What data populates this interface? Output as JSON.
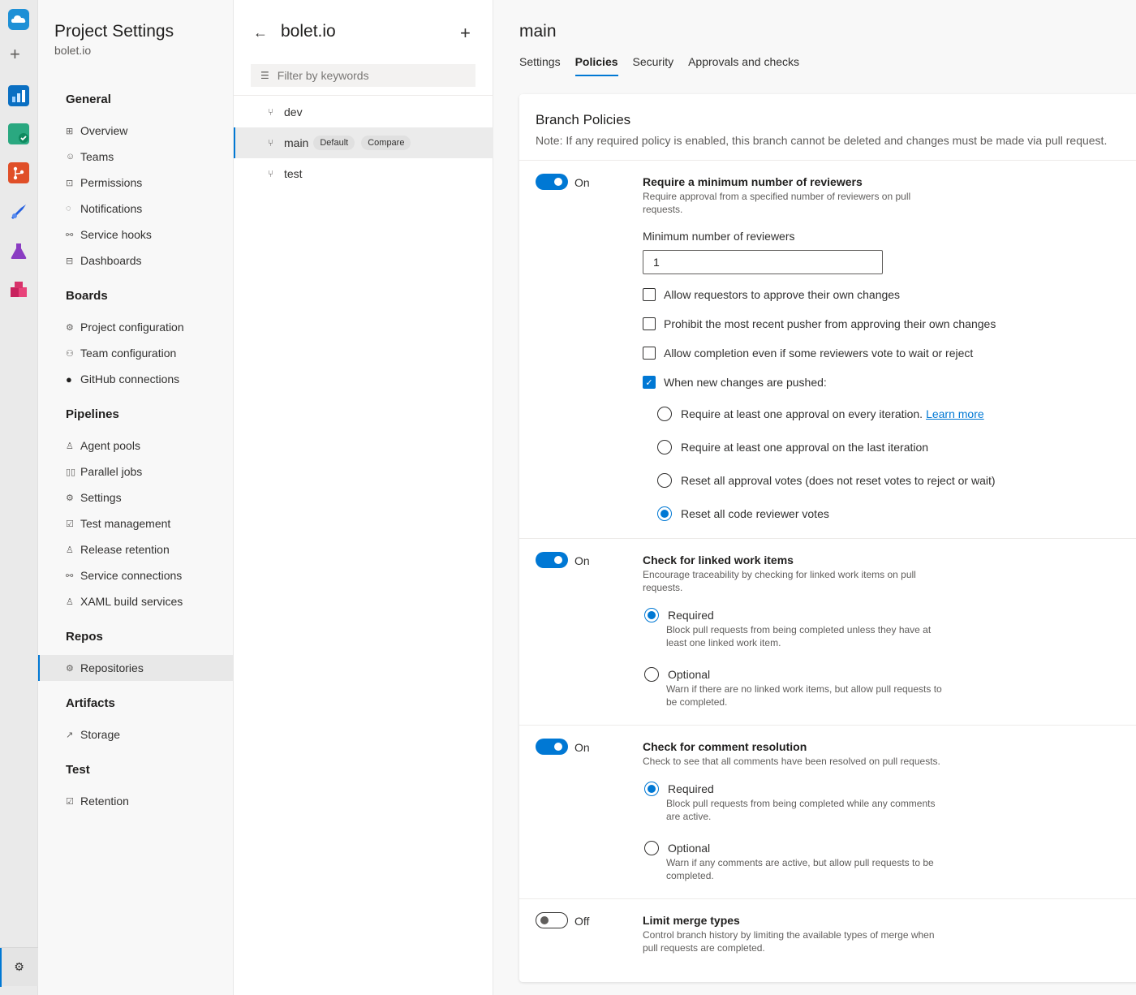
{
  "rail": {
    "icons": [
      "azure-devops-logo-icon",
      "add-icon",
      "boards-icon",
      "test-plans-icon",
      "repos-icon",
      "pipelines-icon",
      "test-flask-icon",
      "artifacts-icon",
      "settings-gear-icon"
    ],
    "gear_glyph": "⚙"
  },
  "sidebar": {
    "title": "Project Settings",
    "subtitle": "bolet.io",
    "sections": {
      "general": "General",
      "boards": "Boards",
      "pipelines": "Pipelines",
      "repos": "Repos",
      "artifacts": "Artifacts",
      "test": "Test"
    },
    "items": {
      "overview": "Overview",
      "teams": "Teams",
      "permissions": "Permissions",
      "notifications": "Notifications",
      "service_hooks": "Service hooks",
      "dashboards": "Dashboards",
      "project_configuration": "Project configuration",
      "team_configuration": "Team configuration",
      "github_connections": "GitHub connections",
      "agent_pools": "Agent pools",
      "parallel_jobs": "Parallel jobs",
      "settings": "Settings",
      "test_management": "Test management",
      "release_retention": "Release retention",
      "service_connections": "Service connections",
      "xaml_build_services": "XAML build services",
      "repositories": "Repositories",
      "storage": "Storage",
      "retention": "Retention"
    }
  },
  "branches": {
    "repo_name": "bolet.io",
    "filter_placeholder": "Filter by keywords",
    "list": [
      {
        "name": "dev"
      },
      {
        "name": "main",
        "badge_default": "Default",
        "badge_compare": "Compare"
      },
      {
        "name": "test"
      }
    ]
  },
  "main": {
    "title": "main",
    "tabs": [
      "Settings",
      "Policies",
      "Security",
      "Approvals and checks"
    ],
    "active_tab": "Policies"
  },
  "policies": {
    "header_title": "Branch Policies",
    "header_note": "Note: If any required policy is enabled, this branch cannot be deleted and changes must be made via pull request.",
    "min_reviewers": {
      "toggle_label": "On",
      "title": "Require a minimum number of reviewers",
      "desc": "Require approval from a specified number of reviewers on pull requests.",
      "field_label": "Minimum number of reviewers",
      "field_value": "1",
      "checkboxes": [
        "Allow requestors to approve their own changes",
        "Prohibit the most recent pusher from approving their own changes",
        "Allow completion even if some reviewers vote to wait or reject",
        "When new changes are pushed:"
      ],
      "radios": [
        "Require at least one approval on every iteration.",
        "Require at least one approval on the last iteration",
        "Reset all approval votes (does not reset votes to reject or wait)",
        "Reset all code reviewer votes"
      ],
      "learn_more": "Learn more"
    },
    "linked_work_items": {
      "toggle_label": "On",
      "title": "Check for linked work items",
      "desc": "Encourage traceability by checking for linked work items on pull requests.",
      "required_label": "Required",
      "required_desc": "Block pull requests from being completed unless they have at least one linked work item.",
      "optional_label": "Optional",
      "optional_desc": "Warn if there are no linked work items, but allow pull requests to be completed."
    },
    "comment_resolution": {
      "toggle_label": "On",
      "title": "Check for comment resolution",
      "desc": "Check to see that all comments have been resolved on pull requests.",
      "required_label": "Required",
      "required_desc": "Block pull requests from being completed while any comments are active.",
      "optional_label": "Optional",
      "optional_desc": "Warn if any comments are active, but allow pull requests to be completed."
    },
    "merge_types": {
      "toggle_label": "Off",
      "title": "Limit merge types",
      "desc": "Control branch history by limiting the available types of merge when pull requests are completed."
    }
  },
  "colors": {
    "accent": "#0078d4"
  }
}
